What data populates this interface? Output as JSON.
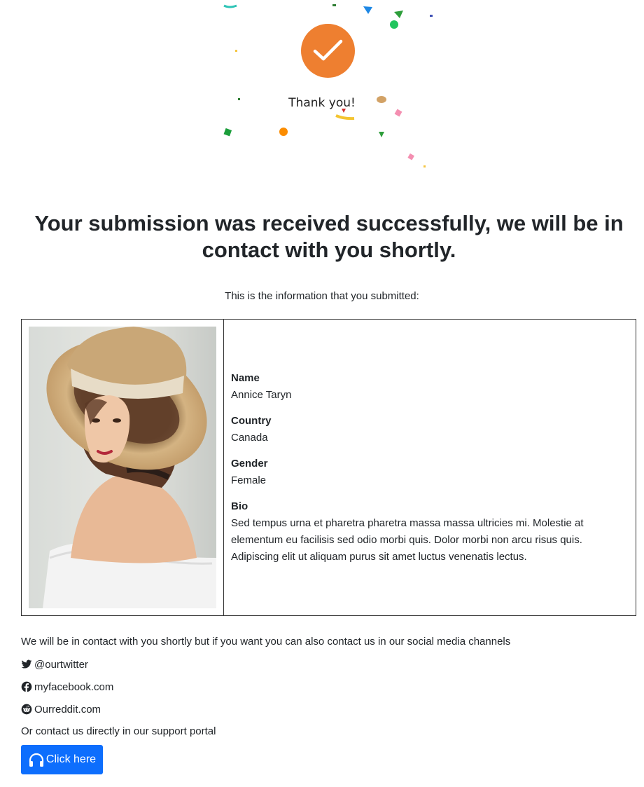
{
  "hero": {
    "thanks_text": "Thank you!",
    "icon": "check-icon",
    "circle_color": "#ee7f30"
  },
  "headline": "Your submission was received successfully, we will be in contact with you shortly.",
  "intro": "This is the information that you submitted:",
  "profile": {
    "photo": "woman-with-sun-hat-photo",
    "fields": [
      {
        "label": "Name",
        "value": "Annice Taryn"
      },
      {
        "label": "Country",
        "value": "Canada"
      },
      {
        "label": "Gender",
        "value": "Female"
      },
      {
        "label": "Bio",
        "value": "Sed tempus urna et pharetra pharetra massa massa ultricies mi. Molestie at elementum eu facilisis sed odio morbi quis. Dolor morbi non arcu risus quis. Adipiscing elit ut aliquam purus sit amet luctus venenatis lectus."
      }
    ]
  },
  "footer": {
    "contact_text": "We will be in contact with you shortly but if you want you can also contact us in our social media channels",
    "socials": [
      {
        "icon": "twitter-icon",
        "label": "@ourtwitter"
      },
      {
        "icon": "facebook-icon",
        "label": "myfacebook.com"
      },
      {
        "icon": "reddit-icon",
        "label": "Ourreddit.com"
      }
    ],
    "support_text": "Or contact us directly in our support portal",
    "button_label": "Click here",
    "button_icon": "headphones-icon",
    "button_color": "#0d6efd"
  }
}
